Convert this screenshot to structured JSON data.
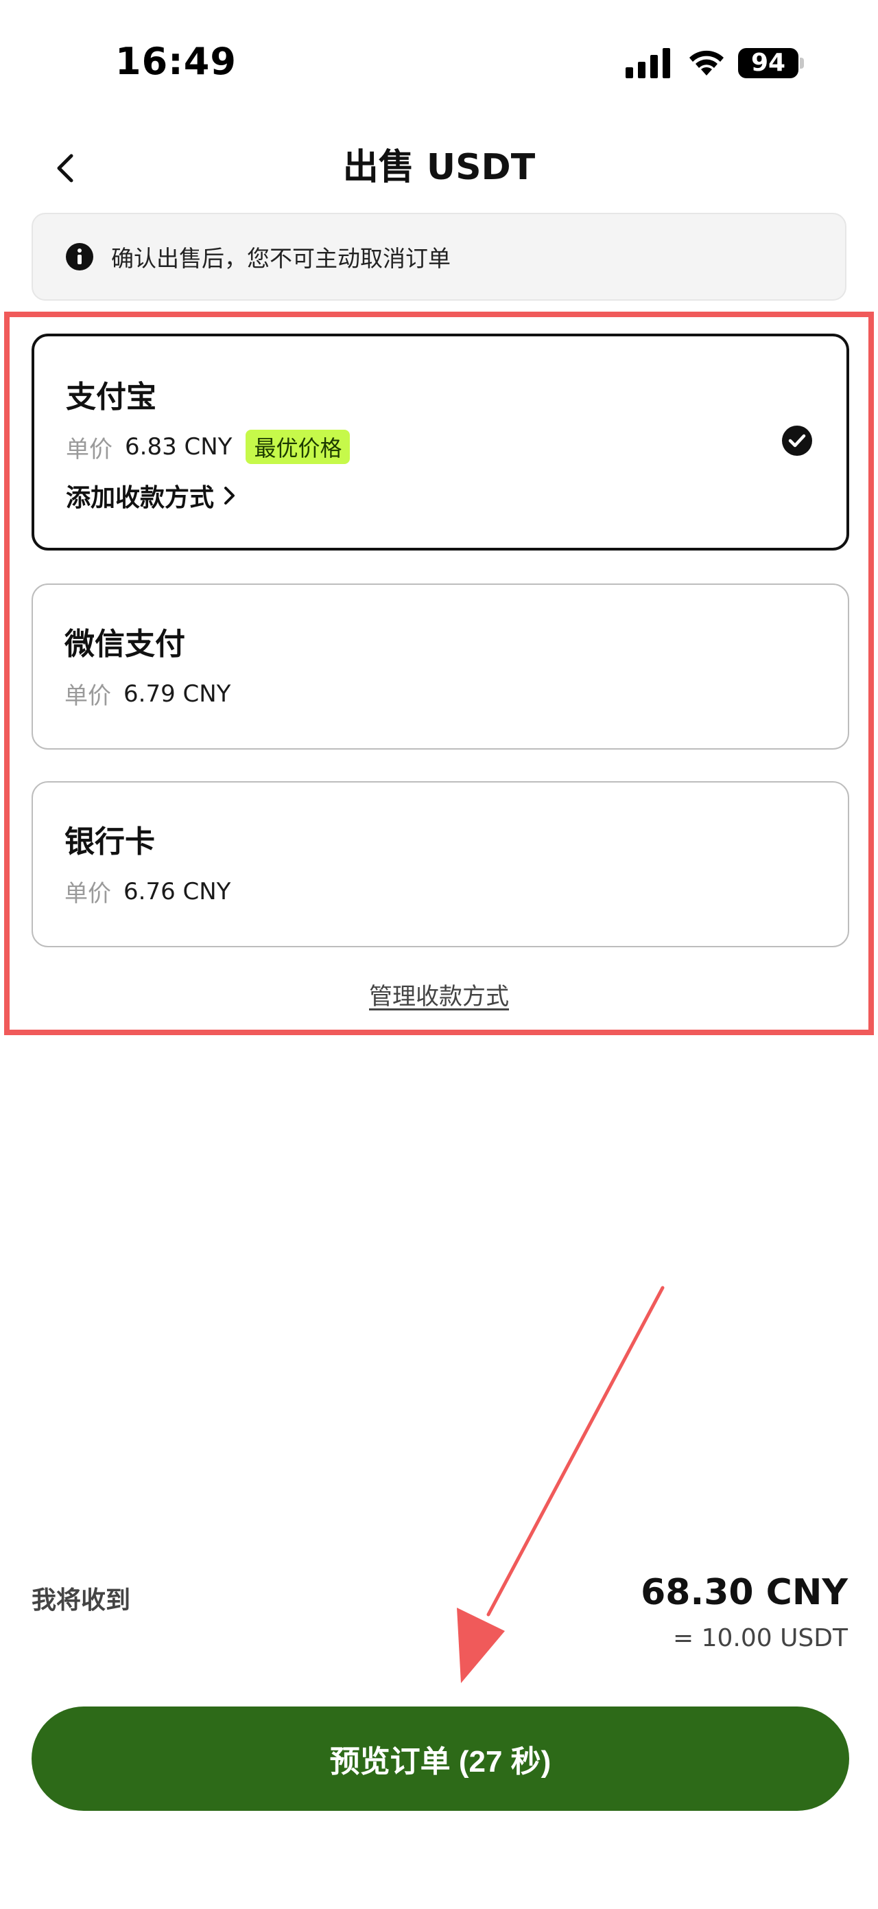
{
  "status_bar": {
    "time": "16:49",
    "battery": "94",
    "icons": [
      "signal-icon",
      "wifi-icon",
      "battery-icon"
    ]
  },
  "header": {
    "title": "出售 USDT",
    "back_icon": "chevron-left-icon"
  },
  "notice": {
    "icon": "info-icon",
    "text": "确认出售后，您不可主动取消订单"
  },
  "payment_methods": [
    {
      "name": "支付宝",
      "price_label": "单价",
      "price": "6.83 CNY",
      "badge": "最优价格",
      "action": "添加收款方式",
      "selected": true
    },
    {
      "name": "微信支付",
      "price_label": "单价",
      "price": "6.79 CNY",
      "selected": false
    },
    {
      "name": "银行卡",
      "price_label": "单价",
      "price": "6.76 CNY",
      "selected": false
    }
  ],
  "manage_link": "管理收款方式",
  "summary": {
    "receive_label": "我将收到",
    "amount": "68.30 CNY",
    "usdt_equiv": "= 10.00 USDT"
  },
  "preview_button": "预览订单 (27 秒)",
  "colors": {
    "accent_button": "#2d6a18",
    "best_badge": "#c6f94a",
    "annotation": "#f05a5a"
  }
}
